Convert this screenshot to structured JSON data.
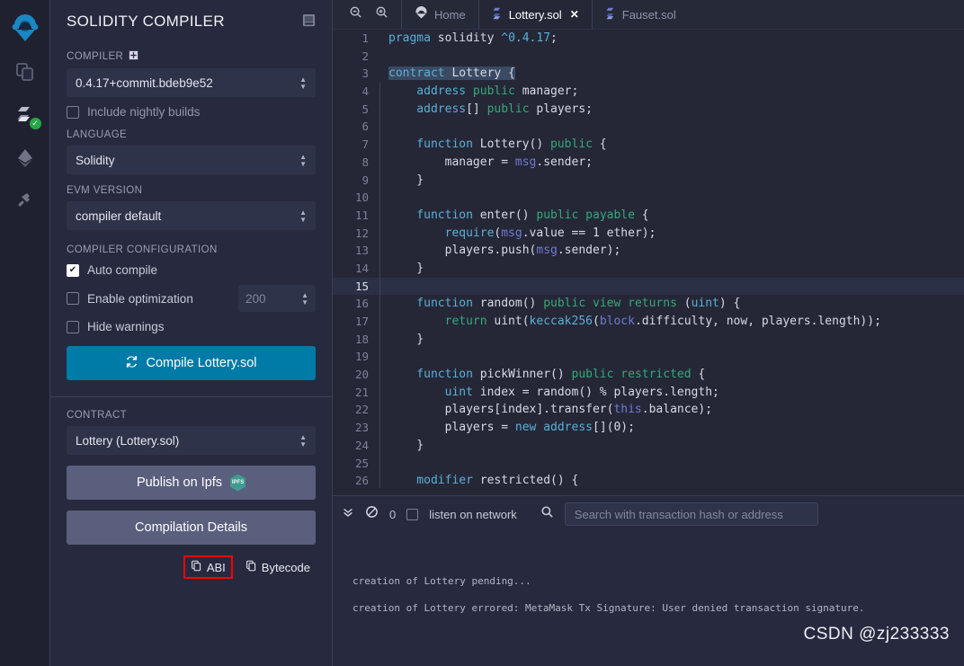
{
  "rail": {
    "items": [
      {
        "name": "remix-logo-icon",
        "label": "Remix"
      },
      {
        "name": "file-explorer-icon",
        "label": "File explorers"
      },
      {
        "name": "solidity-compiler-icon",
        "label": "Solidity compiler"
      },
      {
        "name": "deploy-run-icon",
        "label": "Deploy & run transactions"
      },
      {
        "name": "plugin-manager-icon",
        "label": "Plugin manager"
      }
    ]
  },
  "panel": {
    "title": "SOLIDITY COMPILER",
    "header_icon": "panel-book-icon",
    "compiler_label": "COMPILER",
    "compiler_icon": "add-box-icon",
    "compiler_version": "0.4.17+commit.bdeb9e52",
    "nightly_label": "Include nightly builds",
    "nightly_checked": false,
    "language_label": "LANGUAGE",
    "language_value": "Solidity",
    "evm_label": "EVM VERSION",
    "evm_value": "compiler default",
    "config_label": "COMPILER CONFIGURATION",
    "auto_compile_label": "Auto compile",
    "auto_compile_checked": true,
    "optimization_label": "Enable optimization",
    "optimization_checked": false,
    "optimization_runs": "200",
    "hide_warnings_label": "Hide warnings",
    "hide_warnings_checked": false,
    "compile_button": "Compile Lottery.sol",
    "compile_icon": "refresh-icon",
    "compile_button_color": "#007aa6",
    "contract_label": "CONTRACT",
    "contract_value": "Lottery (Lottery.sol)",
    "publish_ipfs_label": "Publish on Ipfs",
    "ipfs_badge_text": "IPFS",
    "ipfs_badge_color": "#3f9c92",
    "compilation_details_label": "Compilation Details",
    "abi_label": "ABI",
    "abi_icon": "copy-icon",
    "abi_highlight_color": "#ff0000",
    "bytecode_label": "Bytecode",
    "bytecode_icon": "copy-icon"
  },
  "tabbar": {
    "zoom_out_icon": "zoom-out-icon",
    "zoom_in_icon": "zoom-in-icon",
    "tabs": [
      {
        "label": "Home",
        "icon": "remix-home-icon",
        "active": false,
        "closable": false
      },
      {
        "label": "Lottery.sol",
        "icon": "solidity-file-icon",
        "active": true,
        "closable": true
      },
      {
        "label": "Fauset.sol",
        "icon": "solidity-file-icon",
        "active": false,
        "closable": false
      }
    ]
  },
  "editor": {
    "active_line": 15,
    "lines": [
      {
        "n": 1,
        "indent": 0,
        "tokens": [
          {
            "t": "pragma",
            "c": "k"
          },
          {
            "t": " solidity ",
            "c": ""
          },
          {
            "t": "^0.4.17",
            "c": "k"
          },
          {
            "t": ";",
            "c": ""
          }
        ]
      },
      {
        "n": 2,
        "indent": 0,
        "tokens": []
      },
      {
        "n": 3,
        "indent": 0,
        "tokens": [
          {
            "t": "contract",
            "c": "k sel"
          },
          {
            "t": " ",
            "c": "sel"
          },
          {
            "t": "Lottery",
            "c": "sel"
          },
          {
            "t": " ",
            "c": "sel"
          },
          {
            "t": "{",
            "c": "sel"
          }
        ]
      },
      {
        "n": 4,
        "indent": 1,
        "tokens": [
          {
            "t": "    address ",
            "c": "k"
          },
          {
            "t": "public",
            "c": "kg"
          },
          {
            "t": " manager;",
            "c": ""
          }
        ]
      },
      {
        "n": 5,
        "indent": 1,
        "tokens": [
          {
            "t": "    address",
            "c": "k"
          },
          {
            "t": "[] ",
            "c": ""
          },
          {
            "t": "public",
            "c": "kg"
          },
          {
            "t": " players;",
            "c": ""
          }
        ]
      },
      {
        "n": 6,
        "indent": 1,
        "tokens": []
      },
      {
        "n": 7,
        "indent": 1,
        "tokens": [
          {
            "t": "    function",
            "c": "k"
          },
          {
            "t": " Lottery() ",
            "c": ""
          },
          {
            "t": "public",
            "c": "kg"
          },
          {
            "t": " {",
            "c": ""
          }
        ]
      },
      {
        "n": 8,
        "indent": 2,
        "tokens": [
          {
            "t": "        manager = ",
            "c": ""
          },
          {
            "t": "msg",
            "c": "gl"
          },
          {
            "t": ".sender;",
            "c": ""
          }
        ]
      },
      {
        "n": 9,
        "indent": 1,
        "tokens": [
          {
            "t": "    }",
            "c": ""
          }
        ]
      },
      {
        "n": 10,
        "indent": 1,
        "tokens": []
      },
      {
        "n": 11,
        "indent": 1,
        "tokens": [
          {
            "t": "    function",
            "c": "k"
          },
          {
            "t": " enter() ",
            "c": ""
          },
          {
            "t": "public payable",
            "c": "kg"
          },
          {
            "t": " {",
            "c": ""
          }
        ]
      },
      {
        "n": 12,
        "indent": 2,
        "tokens": [
          {
            "t": "        require",
            "c": "k"
          },
          {
            "t": "(",
            "c": ""
          },
          {
            "t": "msg",
            "c": "gl"
          },
          {
            "t": ".value == 1 ether);",
            "c": ""
          }
        ]
      },
      {
        "n": 13,
        "indent": 2,
        "tokens": [
          {
            "t": "        players.push(",
            "c": ""
          },
          {
            "t": "msg",
            "c": "gl"
          },
          {
            "t": ".sender);",
            "c": ""
          }
        ]
      },
      {
        "n": 14,
        "indent": 1,
        "tokens": [
          {
            "t": "    }",
            "c": ""
          }
        ]
      },
      {
        "n": 15,
        "indent": 1,
        "tokens": []
      },
      {
        "n": 16,
        "indent": 1,
        "tokens": [
          {
            "t": "    function",
            "c": "k"
          },
          {
            "t": " random() ",
            "c": ""
          },
          {
            "t": "public view returns",
            "c": "kg"
          },
          {
            "t": " (",
            "c": ""
          },
          {
            "t": "uint",
            "c": "k"
          },
          {
            "t": ") {",
            "c": ""
          }
        ]
      },
      {
        "n": 17,
        "indent": 2,
        "tokens": [
          {
            "t": "        return",
            "c": "kg"
          },
          {
            "t": " uint(",
            "c": ""
          },
          {
            "t": "keccak256",
            "c": "k"
          },
          {
            "t": "(",
            "c": ""
          },
          {
            "t": "block",
            "c": "gl"
          },
          {
            "t": ".difficulty, now, players.length));",
            "c": ""
          }
        ]
      },
      {
        "n": 18,
        "indent": 1,
        "tokens": [
          {
            "t": "    }",
            "c": ""
          }
        ]
      },
      {
        "n": 19,
        "indent": 1,
        "tokens": []
      },
      {
        "n": 20,
        "indent": 1,
        "tokens": [
          {
            "t": "    function",
            "c": "k"
          },
          {
            "t": " pickWinner() ",
            "c": ""
          },
          {
            "t": "public restricted",
            "c": "kg"
          },
          {
            "t": " {",
            "c": ""
          }
        ]
      },
      {
        "n": 21,
        "indent": 2,
        "tokens": [
          {
            "t": "        uint",
            "c": "k"
          },
          {
            "t": " index = random() % players.length;",
            "c": ""
          }
        ]
      },
      {
        "n": 22,
        "indent": 2,
        "tokens": [
          {
            "t": "        players[index].transfer(",
            "c": ""
          },
          {
            "t": "this",
            "c": "gl"
          },
          {
            "t": ".balance);",
            "c": ""
          }
        ]
      },
      {
        "n": 23,
        "indent": 2,
        "tokens": [
          {
            "t": "        players = ",
            "c": ""
          },
          {
            "t": "new",
            "c": "k"
          },
          {
            "t": " address",
            "c": "k"
          },
          {
            "t": "[](0);",
            "c": ""
          }
        ]
      },
      {
        "n": 24,
        "indent": 1,
        "tokens": [
          {
            "t": "    }",
            "c": ""
          }
        ]
      },
      {
        "n": 25,
        "indent": 1,
        "tokens": []
      },
      {
        "n": 26,
        "indent": 1,
        "tokens": [
          {
            "t": "    modifier",
            "c": "k"
          },
          {
            "t": " restricted() {",
            "c": ""
          }
        ]
      }
    ]
  },
  "terminal": {
    "collapse_icon": "double-chevron-down-icon",
    "clear_icon": "ban-circle-icon",
    "count": "0",
    "listen_label": "listen on network",
    "listen_checked": false,
    "search_icon": "search-icon",
    "search_placeholder": "Search with transaction hash or address",
    "search_value": "",
    "log_lines": [
      "creation of Lottery pending...",
      "creation of Lottery errored: MetaMask Tx Signature: User denied transaction signature."
    ]
  },
  "watermark": "CSDN @zj233333"
}
